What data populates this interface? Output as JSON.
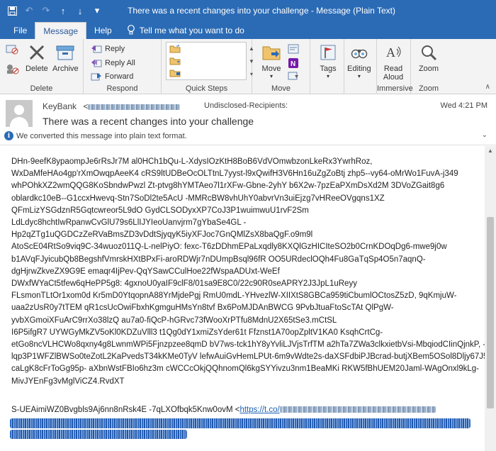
{
  "window": {
    "title": "There was a recent changes into your challenge  -  Message (Plain Text)"
  },
  "tabs": [
    "File",
    "Message",
    "Help"
  ],
  "tell_me": "Tell me what you want to do",
  "ribbon": {
    "delete_group": {
      "label": "Delete",
      "delete": "Delete",
      "archive": "Archive"
    },
    "respond_group": {
      "label": "Respond",
      "reply": "Reply",
      "reply_all": "Reply All",
      "forward": "Forward"
    },
    "quick_steps_group": {
      "label": "Quick Steps"
    },
    "move_group": {
      "label": "Move",
      "move": "Move"
    },
    "tags_group": {
      "tags": "Tags"
    },
    "editing_group": {
      "editing": "Editing"
    },
    "immersive_group": {
      "label": "Immersive",
      "read_aloud_line1": "Read",
      "read_aloud_line2": "Aloud"
    },
    "zoom_group": {
      "label": "Zoom",
      "zoom": "Zoom"
    }
  },
  "message": {
    "sender_name": "KeyBank",
    "sender_open": "<",
    "recipients": "Undisclosed-Recipients:",
    "datetime": "Wed 4:21 PM",
    "subject": "There was a recent changes into your challenge",
    "notice": "We converted this message into plain text format."
  },
  "body_lines": [
    "DHn-9eefK8ypaompJe6rRsJr7M al0HCh1bQu-L-XdysIOzKtH8BoB6VdVOmwbzonLkeRx3YwrhRoz,",
    "WxDaMfeHAo4gp'rXmOwqpAeeK4 cRS9ltUDBeOcOLTtnL7yyst-l9xQwifH3V6Hn16uZgZoBtj zhp5--vy64-oMrWo1FuvA-j349",
    "whPOhkXZ2wmQQG8KoSbndwPwzl Zt-ptvg8hYMTAeo7l1rXFw-Gbne-2yhY b6X2w-7pzEaPXmDsXd2M 3DVoZGait8g6",
    "oblardkc10eB--G1ccxHwevq-Stn7SoDl2te5AcU -MMRcBW8vhUhY0abvrVn3uiEjzg7vHReeOVgqns1XZ",
    "QFmLizYSGdznR5Gqtcwreor5L9dO GydCLSODyxXP7CoJ3P1wuimwuU1rvF2Sm",
    "LdLdyc8hchtIwRpanwCvGlU79s6LlIJYIeoUanvjrm7gYbaSe4GL -",
    "Hp2qZTg1uQGDCzZeRVaBmsZD3vDdtSjyqyK5iyXFJoc7GnQMlZsX8baQgF.o9m9l",
    "AtoScE04RtSo9viq9C-34wuoz011Q-L-nelPiyO: fexc-T6zDDhmEPaLxqdly8KXQlGzHICIteSO2b0CrnKDOqDg6-mwe9j0w",
    "b1AVqFJyicubQb8BegshfVmrskHXtBPxFi-aroRDWjr7nDUmpBsql96fR OO5URdeclOQh4Fu8GaTqSp4O5n7aqnQ-",
    "dgHjrwZkveZX9G9E emaqr4IjPev-QqYSawCCulHoe22fWspaADUxt-WeEf",
    "DWxfWYaCt5tfew6qHePP5g8: 4gxnoU0yaIF9clF8/01sa9E8C0/22c90R0seAPRY2J3JpL1uReyy",
    "FLsmonTLtOr1xom0d Kr5mD0YtqopnA88YrMjdePgj RmU0mdL-YHvezlW-XIIXtS8GBCa959tiCbumlOCtosZ5zD, 9qKmjuW-",
    "uaa2zUsR0y7tTEM qR1csUcOwiFbxhKgmguHMsYn8tvf Bx6PoMJDAnBWCG 9PvbJtuaFtoScTAt QlPgW-",
    "yvbXGmoiXFuArC9rrXo38lzQ au7a0-fiQcP-hGRvc73fWooXrPTfu8MdnU2X65tSe3.mCtSL",
    "I6P5ifgR7 UYWGyMkZV5oKl0KDZuVlll3 t1Qg0dY1xmiZsYder61t Ffznst1A70opZpltV1KA0 KsqhCrtCg-",
    "etGo8ncVLHCWo8qxny4g8LwnmWPi5Fjnzpzee8qmD bV7ws-tck1hY8yYvliLJVjsTrfTM a2hTa7ZWa3clkxietbVsi-MbqiodCIinQjnkP, -",
    "lqp3P1WFZlBWSo0teZotL2KaPvedsT34kKMe0TyV lefwAuiGvHemLPUt-6m9vWdte2s-daXSFdbiPJBcrad-butjXBem5OSol8Dljy67J5P",
    "caLgK8cFrToGg95p- aXbnWstFBIo6hz3m cWCCcOkjQQhnomQl6kgSYYivzu3nm1BeaMKi RKW5fBhUEM20Jaml-WAgOnxl9kLg-",
    "MivJYEnFg3vMglViCZ4.RvdXT"
  ],
  "signature": {
    "text": "S-UEAimiWZ0Bvgbls9Aj6nn8nRsk4E -7qLXOfbqk5Knw0ovM <",
    "link": "https://t.co/"
  }
}
